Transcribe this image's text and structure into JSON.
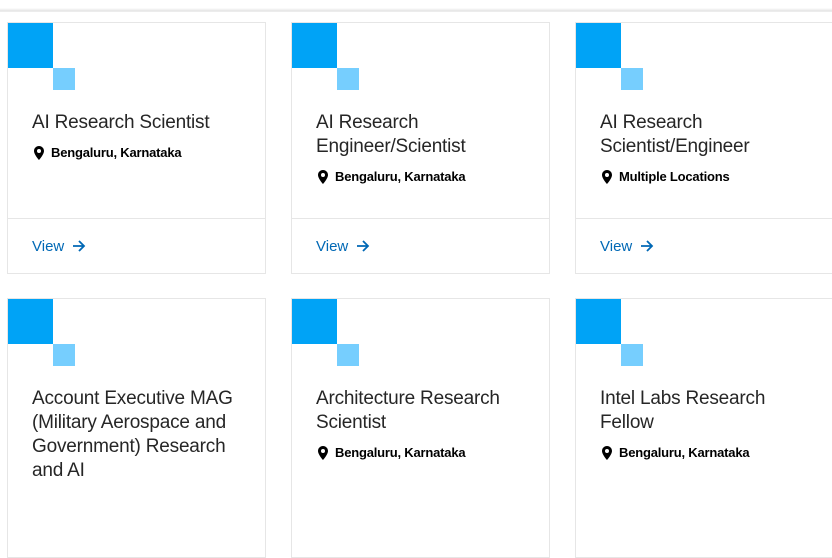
{
  "colors": {
    "deco_primary": "#00a3f6",
    "deco_secondary": "#76cefe",
    "link": "#0068b5"
  },
  "jobs": [
    {
      "title": "AI Research Scientist",
      "location": "Bengaluru, Karnataka",
      "action": "View"
    },
    {
      "title": "AI Research Engineer/Scientist",
      "location": "Bengaluru, Karnataka",
      "action": "View"
    },
    {
      "title": "AI Research Scientist/Engineer",
      "location": "Multiple Locations",
      "action": "View"
    },
    {
      "title": "Account Executive MAG (Military Aerospace and Government) Research and AI",
      "location": "",
      "action": ""
    },
    {
      "title": "Architecture Research Scientist",
      "location": "Bengaluru, Karnataka",
      "action": ""
    },
    {
      "title": "Intel Labs Research Fellow",
      "location": "Bengaluru, Karnataka",
      "action": ""
    }
  ],
  "icons": {
    "location": "map-pin-icon",
    "view": "arrow-right-icon"
  }
}
